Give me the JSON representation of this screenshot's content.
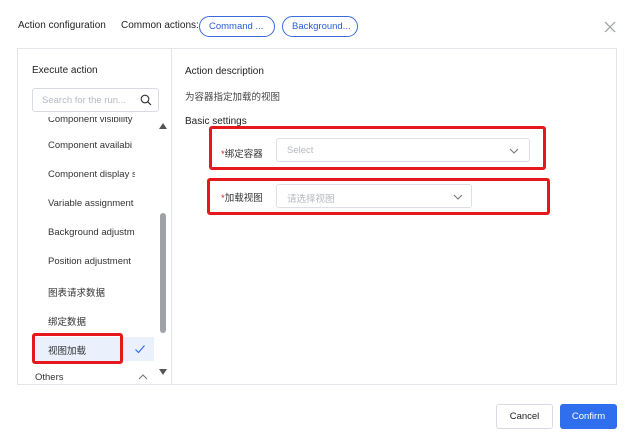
{
  "header": {
    "title": "Action configuration",
    "common_label": "Common actions:",
    "common_actions": [
      "Command ...",
      "Background..."
    ]
  },
  "left_panel": {
    "title": "Execute action",
    "search_placeholder": "Search for the run...",
    "items": [
      "Component visibility",
      "Component availabi",
      "Component display s",
      "Variable assignment",
      "Background adjustm",
      "Position adjustment",
      "图表请求数据",
      "绑定数据",
      "视图加载"
    ],
    "selected_item": "视图加载",
    "footer_group": "Others"
  },
  "right_panel": {
    "desc_title": "Action description",
    "desc_text": "为容器指定加载的视图",
    "basic_title": "Basic settings",
    "fields": [
      {
        "required_mark": "*",
        "label": "绑定容器",
        "placeholder": "Select"
      },
      {
        "required_mark": "*",
        "label": "加载视图",
        "placeholder": "请选择视图"
      }
    ]
  },
  "footer": {
    "cancel_label": "Cancel",
    "confirm_label": "Confirm"
  },
  "colors": {
    "accent": "#2f6fed",
    "highlight": "#e5191c",
    "selected_bg": "#eaf1fd"
  }
}
